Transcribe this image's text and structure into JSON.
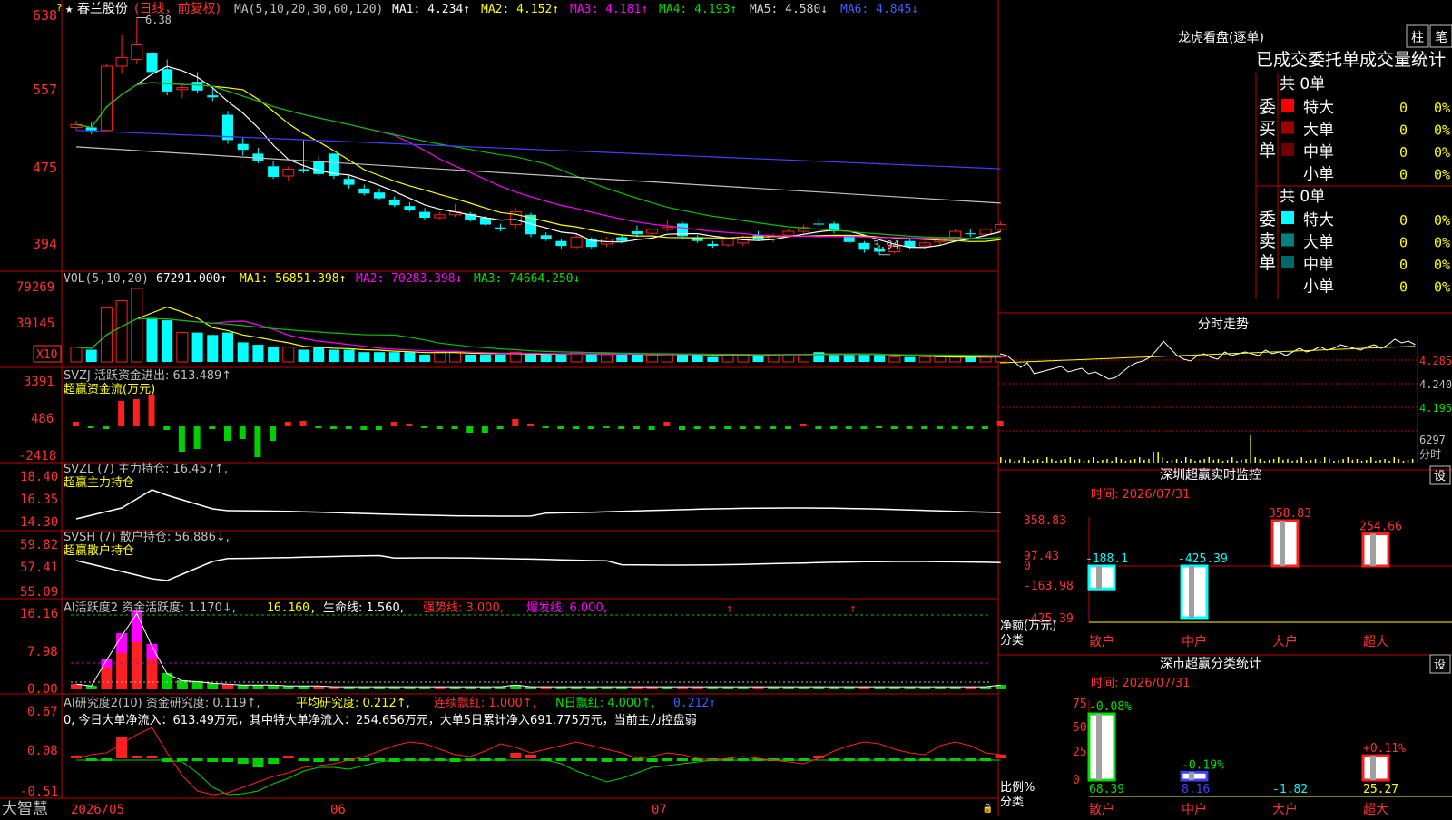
{
  "colors": {
    "up": "#ff2020",
    "down": "#00ffff",
    "grid": "#c00000",
    "ma1": "#ffffff",
    "ma2": "#ffff00",
    "ma3": "#ff00ff",
    "ma4": "#00c000",
    "ma5": "#c0c0c0",
    "ma6": "#4040ff",
    "green": "#00d000",
    "magenta": "#ff00ff"
  },
  "main": {
    "star_icon": "star-icon",
    "stock_name": "春兰股份",
    "period": "(日线，前复权)",
    "ma_params": "MA(5,10,20,30,60,120)",
    "ma1": "MA1: 4.234↑",
    "ma2": "MA2: 4.152↑",
    "ma3": "MA3: 4.181↑",
    "ma4": "MA4: 4.193↑",
    "ma5": "MA5: 4.580↓",
    "ma6": "MA6: 4.845↓",
    "axis": [
      "638",
      "557",
      "475",
      "394"
    ],
    "high_label": "6.38",
    "low_label": "3.94"
  },
  "vol": {
    "title": "VOL(5,10,20)",
    "value": "67291.000↑",
    "ma1": "MA1: 56851.398↑",
    "ma2": "MA2: 70283.398↓",
    "ma3": "MA3: 74664.250↓",
    "axis": [
      "79269",
      "39145"
    ],
    "unit": "X10"
  },
  "svzj": {
    "title": "SVZJ  活跃资金进出: 613.489↑",
    "subtitle": "超赢资金流(万元)",
    "axis": [
      "3391",
      "486",
      "-2418"
    ]
  },
  "svzl": {
    "title": "SVZL (7) 主力持仓: 16.457↑,",
    "subtitle": "超赢主力持仓",
    "axis": [
      "18.40",
      "16.35",
      "14.30"
    ]
  },
  "svsh": {
    "title": "SVSH (7) 散户持仓: 56.886↓,",
    "subtitle": "超赢散户持仓",
    "axis": [
      "59.82",
      "57.41",
      "55.09"
    ]
  },
  "ai1": {
    "title": "AI活跃度2 资金活跃度: 1.170↓,",
    "v2": "16.160,",
    "v3": "生命线: 1.560,",
    "v4": "强势线: 3.000,",
    "v5": "爆发线: 6.000,",
    "axis": [
      "16.16",
      "7.98",
      "0.00"
    ]
  },
  "ai2": {
    "title": "AI研究度2(10) 资金研究度: 0.119↑,",
    "v2": "平均研究度: 0.212↑,",
    "v3": "连续飘红: 1.000↑,",
    "v4": "N日飘红: 4.000↑,",
    "v5": "0.212↑",
    "desc": "0, 今日大单净流入：613.49万元，其中特大单净流入：254.656万元，大单5日累计净入691.775万元，当前主力控盘弱",
    "axis": [
      "0.67",
      "0.08",
      "-0.51"
    ]
  },
  "bottom": {
    "brand": "大智慧",
    "dates": [
      "2026/05",
      "06",
      "07"
    ]
  },
  "lhb": {
    "title": "龙虎看盘(逐单)",
    "tab1": "柱",
    "tab2": "笔",
    "subtitle": "已成交委托单成交量统计",
    "buy_label": "委买单",
    "sell_label": "委卖单",
    "buy_total": "共 0单",
    "sell_total": "共 0单",
    "buy_rows": [
      {
        "name": "特大",
        "count": "0",
        "pct": "0%",
        "color": "#ff0000"
      },
      {
        "name": "大单",
        "count": "0",
        "pct": "0%",
        "color": "#a00000"
      },
      {
        "name": "中单",
        "count": "0",
        "pct": "0%",
        "color": "#700000"
      },
      {
        "name": "小单",
        "count": "0",
        "pct": "0%",
        "color": ""
      }
    ],
    "sell_rows": [
      {
        "name": "特大",
        "count": "0",
        "pct": "0%",
        "color": "#00ffff"
      },
      {
        "name": "大单",
        "count": "0",
        "pct": "0%",
        "color": "#008080"
      },
      {
        "name": "中单",
        "count": "0",
        "pct": "0%",
        "color": "#006868"
      },
      {
        "name": "小单",
        "count": "0",
        "pct": "0%",
        "color": ""
      }
    ]
  },
  "intraday": {
    "title": "分时走势",
    "axis": [
      "4.285",
      "4.240",
      "4.195"
    ],
    "vol_value": "6297",
    "vol_label": "分时"
  },
  "sz_monitor": {
    "title": "深圳超赢实时监控",
    "settings": "设",
    "time": "时间: 2026/07/31",
    "axis": [
      "358.83",
      "97.43",
      "0",
      "-163.98",
      "-425.39"
    ],
    "y_label1": "净额(万元)",
    "y_label2": "分类",
    "categories": [
      "散户",
      "中户",
      "大户",
      "超大"
    ],
    "values": [
      -188.1,
      -425.39,
      358.83,
      254.66
    ],
    "value_labels": [
      "-188.1",
      "-425.39",
      "358.83",
      "254.66"
    ]
  },
  "sz_class": {
    "title": "深市超赢分类统计",
    "settings": "设",
    "time": "时间: 2026/07/31",
    "axis": [
      "75",
      "50",
      "25",
      "0"
    ],
    "y_label1": "比例%",
    "y_label2": "分类",
    "categories": [
      "散户",
      "中户",
      "大户",
      "超大"
    ],
    "values": [
      68.39,
      8.16,
      -1.82,
      25.27
    ],
    "changes": [
      "-0.08%",
      "-0.19%",
      "",
      "+0.11%"
    ],
    "value_labels": [
      "68.39",
      "8.16",
      "-1.82",
      "25.27"
    ]
  },
  "chart_data": {
    "type": "candlestick",
    "title": "春兰股份 (日线，前复权)",
    "ylim": [
      3.9,
      6.45
    ],
    "candles": [
      [
        5.25,
        5.32,
        5.22,
        5.28
      ],
      [
        5.25,
        5.3,
        5.18,
        5.22
      ],
      [
        5.22,
        5.9,
        5.2,
        5.88
      ],
      [
        5.88,
        6.2,
        5.8,
        5.97
      ],
      [
        5.95,
        6.38,
        5.9,
        6.1
      ],
      [
        6.02,
        6.08,
        5.75,
        5.82
      ],
      [
        5.85,
        5.95,
        5.58,
        5.62
      ],
      [
        5.64,
        5.7,
        5.55,
        5.66
      ],
      [
        5.72,
        5.82,
        5.6,
        5.63
      ],
      [
        5.58,
        5.65,
        5.52,
        5.56
      ],
      [
        5.38,
        5.42,
        5.08,
        5.12
      ],
      [
        5.08,
        5.15,
        4.96,
        5.02
      ],
      [
        4.98,
        5.04,
        4.88,
        4.9
      ],
      [
        4.85,
        4.9,
        4.72,
        4.74
      ],
      [
        4.75,
        4.85,
        4.7,
        4.82
      ],
      [
        4.82,
        5.12,
        4.78,
        4.8
      ],
      [
        4.9,
        4.96,
        4.75,
        4.77
      ],
      [
        4.98,
        4.98,
        4.72,
        4.75
      ],
      [
        4.72,
        4.75,
        4.62,
        4.66
      ],
      [
        4.62,
        4.66,
        4.55,
        4.57
      ],
      [
        4.58,
        4.62,
        4.5,
        4.52
      ],
      [
        4.5,
        4.54,
        4.43,
        4.45
      ],
      [
        4.44,
        4.48,
        4.38,
        4.4
      ],
      [
        4.38,
        4.42,
        4.3,
        4.32
      ],
      [
        4.32,
        4.38,
        4.3,
        4.35
      ],
      [
        4.35,
        4.46,
        4.33,
        4.38
      ],
      [
        4.36,
        4.38,
        4.28,
        4.3
      ],
      [
        4.32,
        4.34,
        4.24,
        4.25
      ],
      [
        4.22,
        4.26,
        4.18,
        4.2
      ],
      [
        4.25,
        4.42,
        4.2,
        4.38
      ],
      [
        4.35,
        4.37,
        4.12,
        4.15
      ],
      [
        4.14,
        4.17,
        4.08,
        4.1
      ],
      [
        4.08,
        4.1,
        4.0,
        4.03
      ],
      [
        4.02,
        4.15,
        4.0,
        4.12
      ],
      [
        4.1,
        4.12,
        4.0,
        4.02
      ],
      [
        4.05,
        4.12,
        4.02,
        4.1
      ],
      [
        4.12,
        4.15,
        4.06,
        4.08
      ],
      [
        4.18,
        4.24,
        4.12,
        4.15
      ],
      [
        4.16,
        4.22,
        4.12,
        4.2
      ],
      [
        4.2,
        4.3,
        4.18,
        4.22
      ],
      [
        4.26,
        4.28,
        4.1,
        4.13
      ],
      [
        4.12,
        4.14,
        4.06,
        4.08
      ],
      [
        4.05,
        4.08,
        4.01,
        4.03
      ],
      [
        4.04,
        4.12,
        4.02,
        4.1
      ],
      [
        4.06,
        4.14,
        4.03,
        4.12
      ],
      [
        4.14,
        4.18,
        4.08,
        4.1
      ],
      [
        4.1,
        4.16,
        4.07,
        4.13
      ],
      [
        4.14,
        4.2,
        4.12,
        4.18
      ],
      [
        4.18,
        4.25,
        4.16,
        4.22
      ],
      [
        4.26,
        4.32,
        4.22,
        4.25
      ],
      [
        4.26,
        4.28,
        4.16,
        4.18
      ],
      [
        4.14,
        4.16,
        4.05,
        4.07
      ],
      [
        4.06,
        4.08,
        3.96,
        3.99
      ],
      [
        4.0,
        4.04,
        3.94,
        3.97
      ],
      [
        3.97,
        4.05,
        3.95,
        4.03
      ],
      [
        4.08,
        4.1,
        4.0,
        4.02
      ],
      [
        4.03,
        4.08,
        4.0,
        4.06
      ],
      [
        4.07,
        4.12,
        4.04,
        4.1
      ],
      [
        4.12,
        4.2,
        4.1,
        4.18
      ],
      [
        4.16,
        4.2,
        4.12,
        4.15
      ],
      [
        4.15,
        4.22,
        4.12,
        4.2
      ],
      [
        4.2,
        4.28,
        4.18,
        4.25
      ]
    ],
    "volume": [
      6,
      5,
      22,
      25,
      30,
      18,
      17,
      12,
      12,
      11,
      12,
      8,
      7,
      6,
      6,
      5,
      6,
      5,
      5,
      4,
      4,
      4,
      4,
      3,
      4,
      4,
      3,
      3,
      3,
      4,
      3,
      3,
      3,
      4,
      3,
      3,
      3,
      3,
      3,
      3,
      3,
      3,
      2,
      3,
      3,
      3,
      3,
      3,
      3,
      4,
      3,
      3,
      3,
      3,
      2,
      2,
      2,
      2,
      2,
      2,
      2,
      2
    ]
  }
}
